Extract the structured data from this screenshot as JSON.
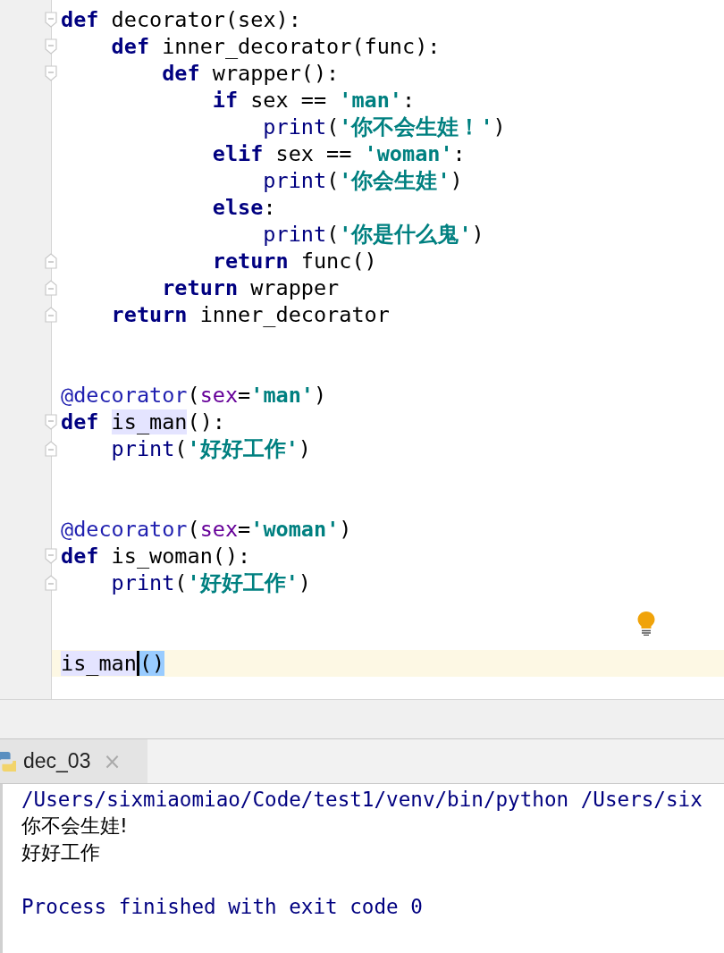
{
  "editor": {
    "lines": [
      {
        "kind": "code",
        "fold_start": true,
        "tokens": [
          {
            "kind": "keyword",
            "text": "def"
          },
          {
            "kind": "plain",
            "text": " decorator(sex):"
          }
        ]
      },
      {
        "kind": "code",
        "fold_start": true,
        "tokens": [
          {
            "kind": "keyword",
            "text": "    def"
          },
          {
            "kind": "plain",
            "text": " inner_decorator(func):"
          }
        ]
      },
      {
        "kind": "code",
        "fold_start": true,
        "tokens": [
          {
            "kind": "keyword",
            "text": "        def"
          },
          {
            "kind": "plain",
            "text": " wrapper():"
          }
        ]
      },
      {
        "kind": "code",
        "tokens": [
          {
            "kind": "keyword",
            "text": "            if"
          },
          {
            "kind": "plain",
            "text": " sex == "
          },
          {
            "kind": "string",
            "text": "'man'"
          },
          {
            "kind": "plain",
            "text": ":"
          }
        ]
      },
      {
        "kind": "code",
        "tokens": [
          {
            "kind": "builtin",
            "text": "                print"
          },
          {
            "kind": "plain",
            "text": "("
          },
          {
            "kind": "string",
            "text": "'你不会生娃！'"
          },
          {
            "kind": "plain",
            "text": ")"
          }
        ]
      },
      {
        "kind": "code",
        "tokens": [
          {
            "kind": "keyword",
            "text": "            elif"
          },
          {
            "kind": "plain",
            "text": " sex == "
          },
          {
            "kind": "string",
            "text": "'woman'"
          },
          {
            "kind": "plain",
            "text": ":"
          }
        ]
      },
      {
        "kind": "code",
        "tokens": [
          {
            "kind": "builtin",
            "text": "                print"
          },
          {
            "kind": "plain",
            "text": "("
          },
          {
            "kind": "string",
            "text": "'你会生娃'"
          },
          {
            "kind": "plain",
            "text": ")"
          }
        ]
      },
      {
        "kind": "code",
        "tokens": [
          {
            "kind": "keyword",
            "text": "            else"
          },
          {
            "kind": "plain",
            "text": ":"
          }
        ]
      },
      {
        "kind": "code",
        "tokens": [
          {
            "kind": "builtin",
            "text": "                print"
          },
          {
            "kind": "plain",
            "text": "("
          },
          {
            "kind": "string",
            "text": "'你是什么鬼'"
          },
          {
            "kind": "plain",
            "text": ")"
          }
        ]
      },
      {
        "kind": "code",
        "fold_end": true,
        "tokens": [
          {
            "kind": "keyword",
            "text": "            return"
          },
          {
            "kind": "plain",
            "text": " func()"
          }
        ]
      },
      {
        "kind": "code",
        "fold_end": true,
        "tokens": [
          {
            "kind": "keyword",
            "text": "        return"
          },
          {
            "kind": "plain",
            "text": " wrapper"
          }
        ]
      },
      {
        "kind": "code",
        "fold_end": true,
        "tokens": [
          {
            "kind": "keyword",
            "text": "    return"
          },
          {
            "kind": "plain",
            "text": " inner_decorator"
          }
        ]
      },
      {
        "kind": "blank"
      },
      {
        "kind": "blank"
      },
      {
        "kind": "code",
        "tokens": [
          {
            "kind": "decorator",
            "text": "@decorator"
          },
          {
            "kind": "plain",
            "text": "("
          },
          {
            "kind": "param",
            "text": "sex"
          },
          {
            "kind": "plain",
            "text": "="
          },
          {
            "kind": "string",
            "text": "'man'"
          },
          {
            "kind": "plain",
            "text": ")"
          }
        ]
      },
      {
        "kind": "code",
        "fold_start": true,
        "tokens": [
          {
            "kind": "keyword",
            "text": "def "
          },
          {
            "kind": "usage",
            "text": "is_man"
          },
          {
            "kind": "plain",
            "text": "():"
          }
        ]
      },
      {
        "kind": "code",
        "fold_end": true,
        "tokens": [
          {
            "kind": "builtin",
            "text": "    print"
          },
          {
            "kind": "plain",
            "text": "("
          },
          {
            "kind": "string",
            "text": "'好好工作'"
          },
          {
            "kind": "plain",
            "text": ")"
          }
        ]
      },
      {
        "kind": "blank"
      },
      {
        "kind": "blank"
      },
      {
        "kind": "code",
        "tokens": [
          {
            "kind": "decorator",
            "text": "@decorator"
          },
          {
            "kind": "plain",
            "text": "("
          },
          {
            "kind": "param",
            "text": "sex"
          },
          {
            "kind": "plain",
            "text": "="
          },
          {
            "kind": "string",
            "text": "'woman'"
          },
          {
            "kind": "plain",
            "text": ")"
          }
        ]
      },
      {
        "kind": "code",
        "fold_start": true,
        "tokens": [
          {
            "kind": "keyword",
            "text": "def"
          },
          {
            "kind": "plain",
            "text": " is_woman():"
          }
        ]
      },
      {
        "kind": "code",
        "fold_end": true,
        "tokens": [
          {
            "kind": "builtin",
            "text": "    print"
          },
          {
            "kind": "plain",
            "text": "("
          },
          {
            "kind": "string",
            "text": "'好好工作'"
          },
          {
            "kind": "plain",
            "text": ")"
          }
        ]
      },
      {
        "kind": "blank"
      },
      {
        "kind": "blank",
        "lightbulb": true
      },
      {
        "kind": "code",
        "current": true,
        "tokens": [
          {
            "kind": "usage",
            "text": "is_man"
          },
          {
            "kind": "bracematch",
            "caret": true,
            "text": "()"
          }
        ]
      }
    ]
  },
  "run_panel": {
    "tabs": [
      {
        "label": "dec_03",
        "close": "×",
        "selected": true
      }
    ],
    "console": [
      {
        "kind": "system",
        "text": "/Users/sixmiaomiao/Code/test1/venv/bin/python /Users/six"
      },
      {
        "kind": "output",
        "text": "你不会生娃!"
      },
      {
        "kind": "output",
        "text": "好好工作"
      },
      {
        "kind": "system",
        "gap_before": true,
        "text": "Process finished with exit code 0"
      }
    ]
  }
}
